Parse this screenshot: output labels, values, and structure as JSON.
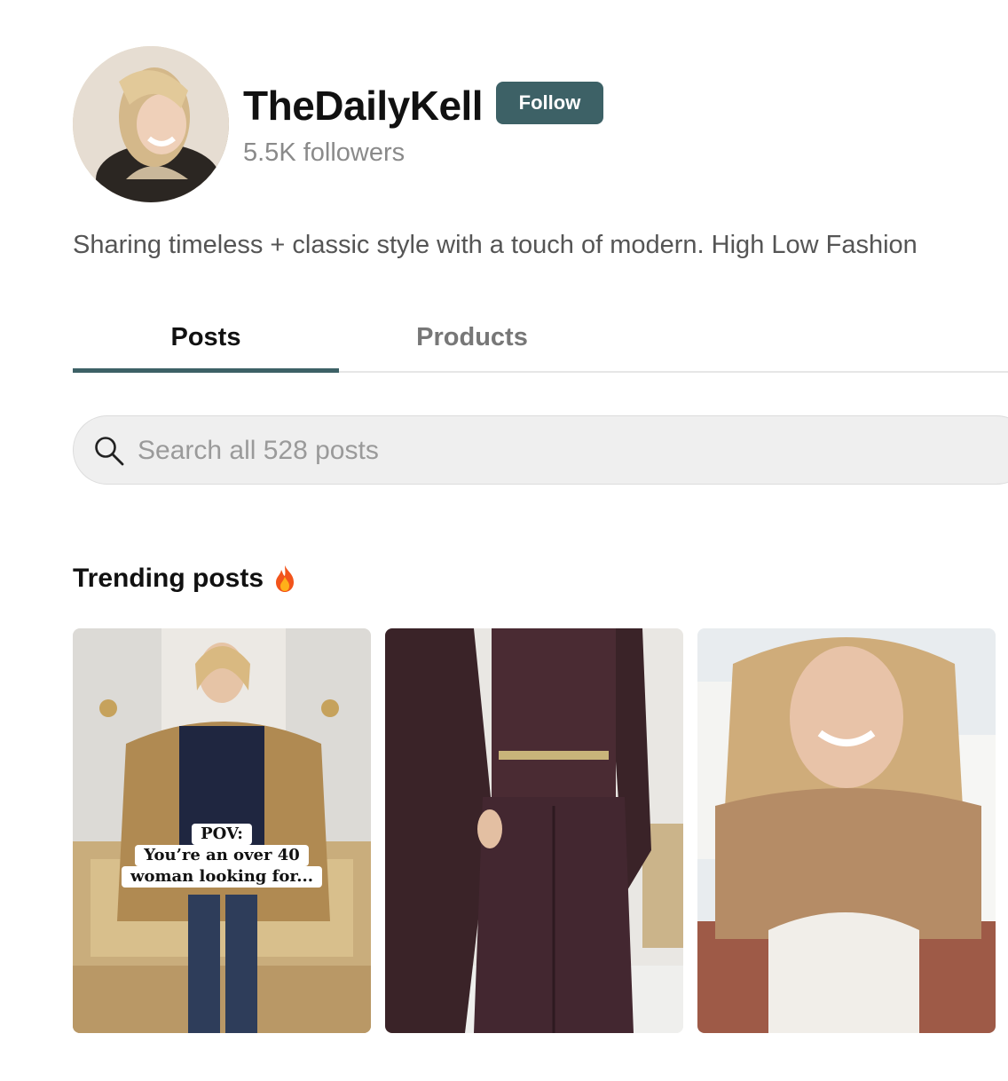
{
  "profile": {
    "name": "TheDailyKell",
    "follow_label": "Follow",
    "followers": "5.5K followers",
    "bio": "Sharing timeless + classic style with a touch of modern. High Low Fashion"
  },
  "tabs": [
    {
      "label": "Posts",
      "active": true
    },
    {
      "label": "Products",
      "active": false
    }
  ],
  "search": {
    "placeholder": "Search all 528 posts",
    "icon": "search-icon"
  },
  "trending": {
    "title": "Trending posts",
    "icon": "fire-icon",
    "posts": [
      {
        "overlay_lines": [
          "POV:",
          "You’re an over 40",
          "woman looking for..."
        ]
      },
      {
        "overlay_lines": []
      },
      {
        "overlay_lines": []
      }
    ]
  },
  "colors": {
    "accent": "#3d6166",
    "tab_inactive": "#777777",
    "muted_text": "#8a8a8a"
  }
}
